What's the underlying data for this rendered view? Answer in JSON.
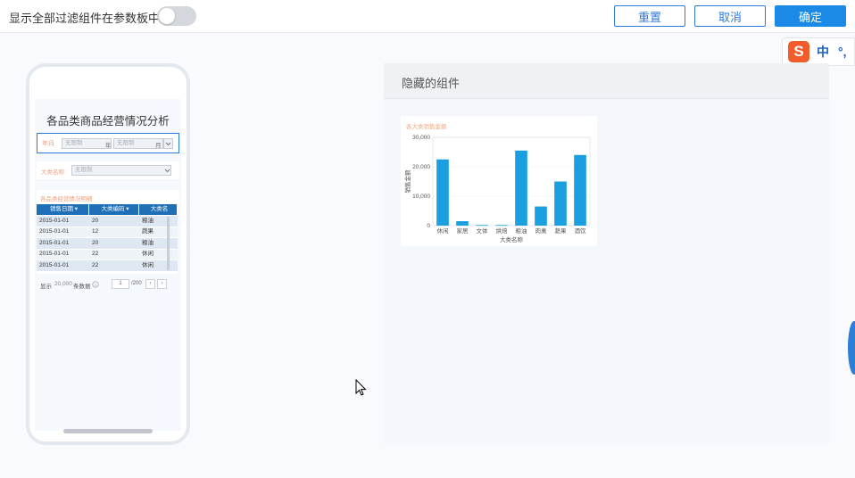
{
  "topbar": {
    "show_all_label": "显示全部过滤组件在参数板中",
    "reset_label": "重置",
    "cancel_label": "取消",
    "confirm_label": "确定"
  },
  "ime": {
    "zh_label": "中",
    "punct_label": "°,"
  },
  "mobile": {
    "title": "各品类商品经营情况分析",
    "year_month_label": "年月",
    "unlimited_1": "无限制",
    "year_unit": "年",
    "unlimited_2": "无限制",
    "month_unit": "月",
    "category_label": "大类名称",
    "unlimited_3": "无限制",
    "table_title": "各品类经营情况明细",
    "columns": [
      "销售日期",
      "大类编码",
      "大类名"
    ],
    "rows": [
      [
        "2015-01-01",
        "20",
        "粮油"
      ],
      [
        "2015-01-01",
        "12",
        "蔬果"
      ],
      [
        "2015-01-01",
        "20",
        "粮油"
      ],
      [
        "2015-01-01",
        "22",
        "休闲"
      ],
      [
        "2015-01-01",
        "22",
        "休闲"
      ]
    ],
    "footer_show": "显示",
    "footer_count": "20,000",
    "footer_rows": "条数据",
    "page_current": "1",
    "page_total": "/200"
  },
  "panel": {
    "title": "隐藏的组件"
  },
  "chart_data": {
    "type": "bar",
    "title": "各大类销售金额",
    "xlabel": "大类名称",
    "ylabel": "销售金额",
    "categories": [
      "休闲",
      "家居",
      "文体",
      "烘焙",
      "粮油",
      "肉禽",
      "蔬果",
      "酒饮"
    ],
    "values": [
      22500,
      1500,
      200,
      200,
      25500,
      6500,
      15000,
      24000
    ],
    "ylim": [
      0,
      30000
    ],
    "yticks": [
      "0",
      "10,000",
      "20,000",
      "30,000"
    ],
    "bar_color": "#1a9fe0"
  }
}
